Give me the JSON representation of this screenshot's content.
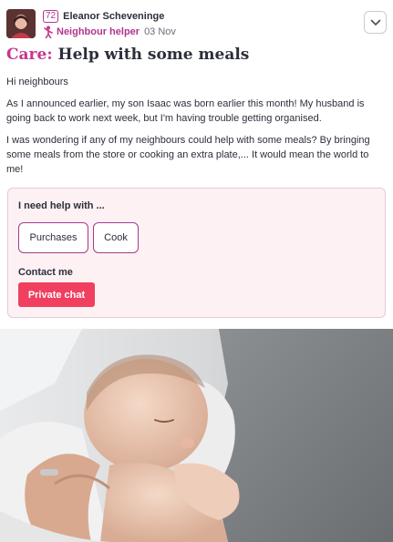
{
  "author": {
    "level": "72",
    "name": "Eleanor Scheveninge",
    "role": "Neighbour helper",
    "date": "03 Nov"
  },
  "post": {
    "category": "Care:",
    "title": "Help with some meals",
    "paragraphs": [
      "Hi neighbours",
      "As I announced earlier, my son Isaac was born earlier this month! My husband is going back to work next week, but I'm having trouble getting organised.",
      "I was wondering if any of my neighbours could help with some meals? By bringing some meals from the store or cooking an extra plate,... It would mean the world to me!"
    ]
  },
  "help": {
    "heading": "I need help with ...",
    "items": [
      "Purchases",
      "Cook"
    ],
    "contact_heading": "Contact me",
    "contact_button": "Private chat"
  },
  "colors": {
    "accent_magenta": "#c7358e",
    "chat_button": "#f03f5f",
    "card_background": "#fdf1f4"
  },
  "icons": {
    "menu": "chevron-down-icon",
    "role": "person-waving-icon"
  }
}
